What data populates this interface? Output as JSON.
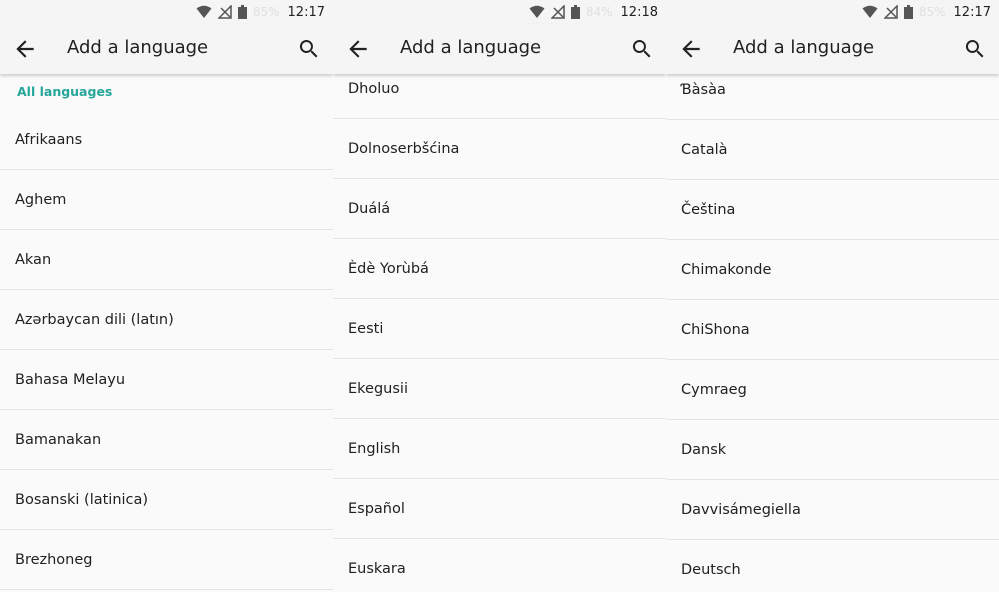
{
  "screens": [
    {
      "status": {
        "battery": "85%",
        "time": "12:17"
      },
      "title": "Add a language",
      "section_header": "All languages",
      "languages": [
        "Afrikaans",
        "Aghem",
        "Akan",
        "Azərbaycan dili (latın)",
        "Bahasa Melayu",
        "Bamanakan",
        "Bosanski (latinica)",
        "Brezhoneg"
      ]
    },
    {
      "status": {
        "battery": "84%",
        "time": "12:18"
      },
      "title": "Add a language",
      "languages": [
        "Dholuo",
        "Dolnoserbšćina",
        "Duálá",
        "Èdè Yorùbá",
        "Eesti",
        "Ekegusii",
        "English",
        "Español",
        "Euskara"
      ]
    },
    {
      "status": {
        "battery": "85%",
        "time": "12:17"
      },
      "title": "Add a language",
      "languages": [
        "Ɓàsàa",
        "Català",
        "Čeština",
        "Chimakonde",
        "ChiShona",
        "Cymraeg",
        "Dansk",
        "Davvisámegiella",
        "Deutsch"
      ]
    }
  ],
  "icons": {
    "back": "arrow-back-icon",
    "search": "search-icon",
    "wifi": "wifi-icon",
    "signal": "no-signal-icon",
    "battery": "battery-icon"
  },
  "colors": {
    "accent": "#26a69a",
    "text": "#212121",
    "background": "#fafafa",
    "appbar": "#f5f5f5"
  }
}
